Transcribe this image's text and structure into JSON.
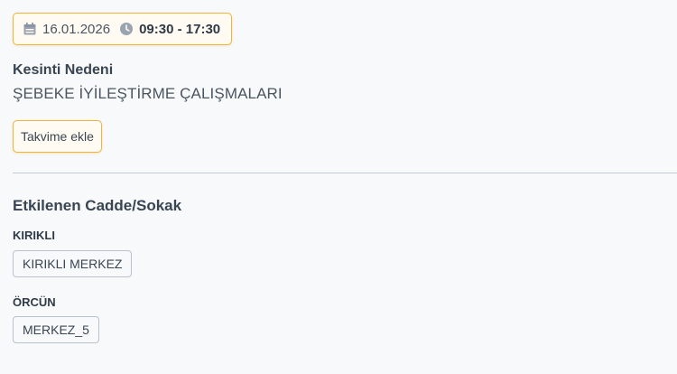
{
  "outage": {
    "date": "16.01.2026",
    "time_range": "09:30 - 17:30",
    "reason_heading": "Kesinti Nedeni",
    "reason_value": "ŞEBEKE İYİLEŞTİRME ÇALIŞMALARI",
    "add_to_calendar_label": "Takvime ekle"
  },
  "affected": {
    "heading": "Etkilenen Cadde/Sokak",
    "groups": [
      {
        "name": "KIRIKLI",
        "streets": [
          "KIRIKLI MERKEZ"
        ]
      },
      {
        "name": "ÖRCÜN",
        "streets": [
          "MERKEZ_5"
        ]
      }
    ]
  },
  "icons": {
    "date": "calendar-icon",
    "time": "clock-icon"
  },
  "colors": {
    "accent": "#f0b43a",
    "text": "#2f3a46",
    "muted": "#4a5561",
    "chip_border": "#b9c1cc",
    "divider": "#c6ccd6",
    "background": "#f8f9fb"
  }
}
